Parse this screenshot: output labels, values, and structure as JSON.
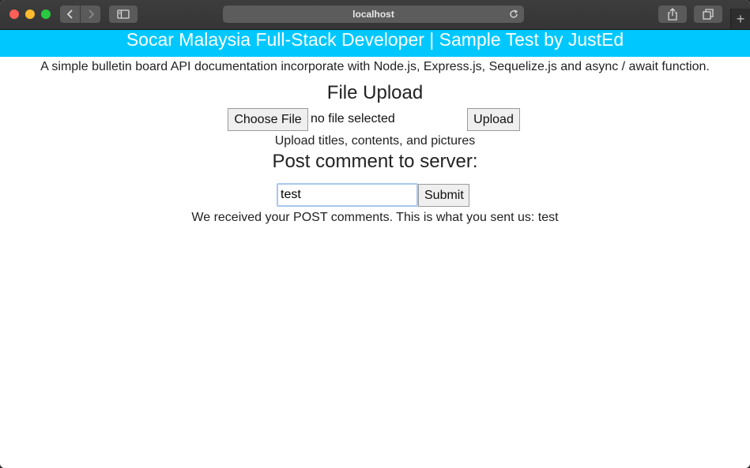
{
  "browser": {
    "address": "localhost",
    "new_tab_glyph": "+"
  },
  "header": {
    "title": "Socar Malaysia Full-Stack Developer | Sample Test by JustEd",
    "subtitle": "A simple bulletin board API documentation incorporate with Node.js, Express.js, Sequelize.js and async / await function."
  },
  "upload": {
    "heading": "File Upload",
    "choose_label": "Choose File",
    "file_status": "no file selected",
    "upload_label": "Upload",
    "note": "Upload titles, contents, and pictures"
  },
  "post": {
    "heading": "Post comment to server:",
    "input_value": "test",
    "submit_label": "Submit",
    "response": "We received your POST comments. This is what you sent us: test"
  },
  "colors": {
    "banner": "#00c8ff",
    "toolbar": "#3a3a3a"
  }
}
